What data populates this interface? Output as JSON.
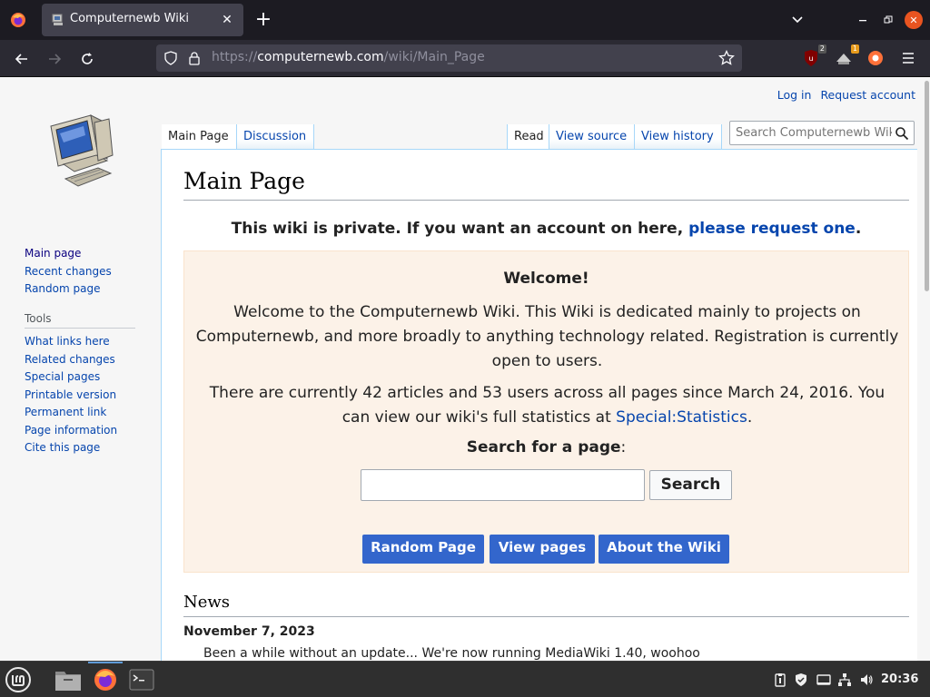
{
  "browser": {
    "tab_title": "Computernewb Wiki",
    "url_scheme": "https://",
    "url_host": "computernewb.com",
    "url_path": "/wiki/Main_Page",
    "ext_badge_ublock": "2",
    "ext_badge_second": "1",
    "accent_color": "#e95420"
  },
  "wiki": {
    "personal": {
      "login": "Log in",
      "request_account": "Request account"
    },
    "tabs": {
      "main_page": "Main Page",
      "discussion": "Discussion",
      "read": "Read",
      "view_source": "View source",
      "view_history": "View history"
    },
    "search_placeholder": "Search Computernewb Wiki",
    "nav": {
      "items": [
        "Main page",
        "Recent changes",
        "Random page"
      ]
    },
    "tools": {
      "heading": "Tools",
      "items": [
        "What links here",
        "Related changes",
        "Special pages",
        "Printable version",
        "Permanent link",
        "Page information",
        "Cite this page"
      ]
    },
    "heading": "Main Page",
    "notice_text": "This wiki is private. If you want an account on here, ",
    "notice_link": "please request one",
    "notice_end": ".",
    "welcome": {
      "title": "Welcome!",
      "p1": "Welcome to the Computernewb Wiki. This Wiki is dedicated mainly to projects on Computernewb, and more broadly to anything technology related. Registration is currently open to users.",
      "p2": "There are currently 42 articles and 53 users across all pages since March 24, 2016. You can view our wiki's full statistics at ",
      "p2_link": "Special:Statistics",
      "p2_end": ".",
      "search_label": "Search for a page",
      "search_colon": ":",
      "search_button": "Search",
      "buttons": [
        "Random Page",
        "View pages",
        "About the Wiki"
      ]
    },
    "news": {
      "heading": "News",
      "date": "November 7, 2023",
      "item": "Been a while without an update... We're now running MediaWiki 1.40, woohoo"
    }
  },
  "taskbar": {
    "clock": "20:36"
  }
}
